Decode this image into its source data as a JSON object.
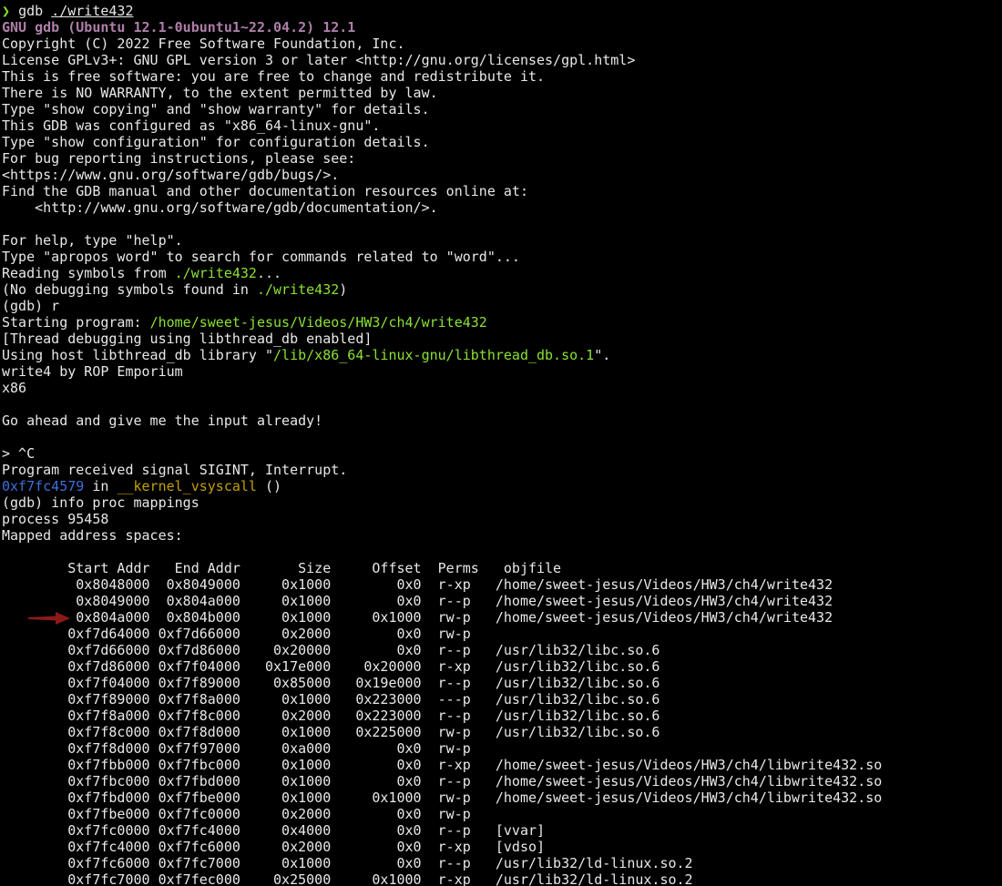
{
  "colors": {
    "background": "#000000",
    "text": "#e8e8e8",
    "prompt": "#8ae234",
    "banner": "#ad7fa8",
    "path": "#8ae234",
    "address": "#3f70d8",
    "function": "#c4a000",
    "arrow": "#8b1a1a"
  },
  "icons": {
    "prompt": "prompt-chevron-icon",
    "arrow": "red-arrow-annotation-icon"
  },
  "prompt": {
    "symbol": "❯",
    "command": "gdb",
    "argument": "./write432"
  },
  "banner": "GNU gdb (Ubuntu 12.1-0ubuntu1~22.04.2) 12.1",
  "intro_lines": [
    "Copyright (C) 2022 Free Software Foundation, Inc.",
    "License GPLv3+: GNU GPL version 3 or later <http://gnu.org/licenses/gpl.html>",
    "This is free software: you are free to change and redistribute it.",
    "There is NO WARRANTY, to the extent permitted by law.",
    "Type \"show copying\" and \"show warranty\" for details.",
    "This GDB was configured as \"x86_64-linux-gnu\".",
    "Type \"show configuration\" for configuration details.",
    "For bug reporting instructions, please see:",
    "<https://www.gnu.org/software/gdb/bugs/>.",
    "Find the GDB manual and other documentation resources online at:",
    "    <http://www.gnu.org/software/gdb/documentation/>.",
    "",
    "For help, type \"help\".",
    "Type \"apropos word\" to search for commands related to \"word\"..."
  ],
  "reading": {
    "prefix": "Reading symbols from ",
    "path": "./write432",
    "suffix": "..."
  },
  "nodebug": {
    "prefix": "(No debugging symbols found in ",
    "path": "./write432",
    "suffix": ")"
  },
  "run_command": "(gdb) r",
  "starting": {
    "prefix": "Starting program: ",
    "path": "/home/sweet-jesus/Videos/HW3/ch4/write432"
  },
  "thread_debugging": "[Thread debugging using libthread_db enabled]",
  "libthread": {
    "prefix": "Using host libthread_db library \"",
    "path": "/lib/x86_64-linux-gnu/libthread_db.so.1",
    "suffix": "\"."
  },
  "program_output": [
    "write4 by ROP Emporium",
    "x86",
    "",
    "Go ahead and give me the input already!",
    "",
    "> ^C",
    "Program received signal SIGINT, Interrupt."
  ],
  "stop_location": {
    "address": "0xf7fc4579",
    "in_word": " in ",
    "function": "__kernel_vsyscall",
    "suffix": " ()"
  },
  "info_command": "(gdb) info proc mappings",
  "process_line": "process 95458",
  "mapped_line": "Mapped address spaces:",
  "mappings": {
    "header": "        Start Addr   End Addr       Size     Offset  Perms   objfile",
    "rows": [
      "         0x8048000  0x8049000     0x1000        0x0  r-xp   /home/sweet-jesus/Videos/HW3/ch4/write432",
      "         0x8049000  0x804a000     0x1000        0x0  r--p   /home/sweet-jesus/Videos/HW3/ch4/write432",
      "         0x804a000  0x804b000     0x1000     0x1000  rw-p   /home/sweet-jesus/Videos/HW3/ch4/write432",
      "        0xf7d64000 0xf7d66000     0x2000        0x0  rw-p",
      "        0xf7d66000 0xf7d86000    0x20000        0x0  r--p   /usr/lib32/libc.so.6",
      "        0xf7d86000 0xf7f04000   0x17e000    0x20000  r-xp   /usr/lib32/libc.so.6",
      "        0xf7f04000 0xf7f89000    0x85000   0x19e000  r--p   /usr/lib32/libc.so.6",
      "        0xf7f89000 0xf7f8a000     0x1000   0x223000  ---p   /usr/lib32/libc.so.6",
      "        0xf7f8a000 0xf7f8c000     0x2000   0x223000  r--p   /usr/lib32/libc.so.6",
      "        0xf7f8c000 0xf7f8d000     0x1000   0x225000  rw-p   /usr/lib32/libc.so.6",
      "        0xf7f8d000 0xf7f97000     0xa000        0x0  rw-p",
      "        0xf7fbb000 0xf7fbc000     0x1000        0x0  r-xp   /home/sweet-jesus/Videos/HW3/ch4/libwrite432.so",
      "        0xf7fbc000 0xf7fbd000     0x1000        0x0  r--p   /home/sweet-jesus/Videos/HW3/ch4/libwrite432.so",
      "        0xf7fbd000 0xf7fbe000     0x1000     0x1000  rw-p   /home/sweet-jesus/Videos/HW3/ch4/libwrite432.so",
      "        0xf7fbe000 0xf7fc0000     0x2000        0x0  rw-p",
      "        0xf7fc0000 0xf7fc4000     0x4000        0x0  r--p   [vvar]",
      "        0xf7fc4000 0xf7fc6000     0x2000        0x0  r-xp   [vdso]",
      "        0xf7fc6000 0xf7fc7000     0x1000        0x0  r--p   /usr/lib32/ld-linux.so.2",
      "        0xf7fc7000 0xf7fec000    0x25000     0x1000  r-xp   /usr/lib32/ld-linux.so.2"
    ]
  }
}
